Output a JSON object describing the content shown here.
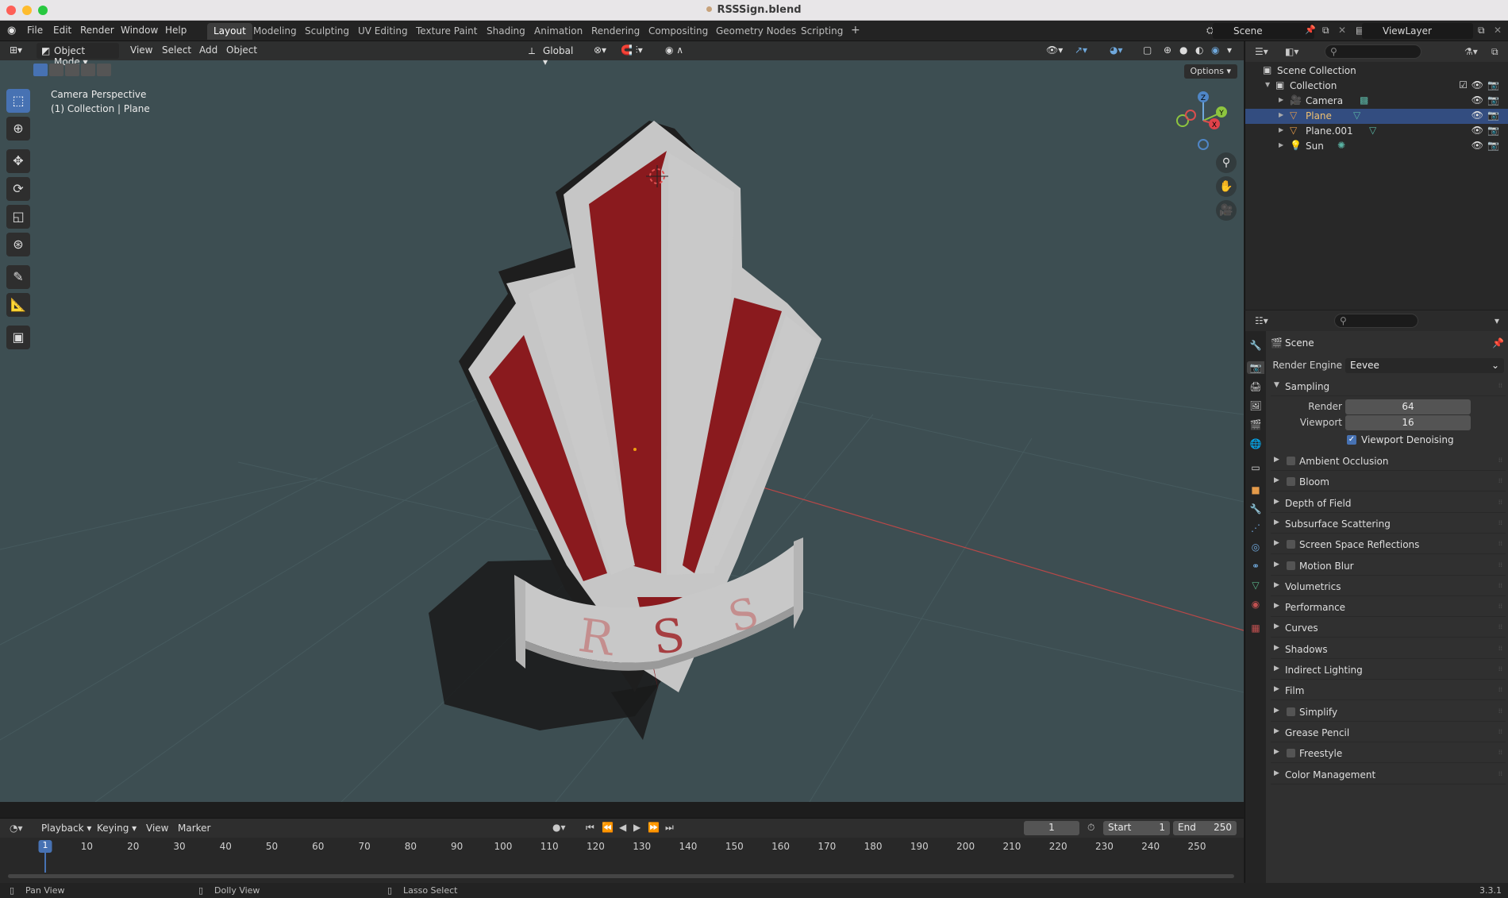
{
  "window": {
    "title": "RSSSign.blend"
  },
  "menu": {
    "items": [
      "File",
      "Edit",
      "Render",
      "Window",
      "Help"
    ]
  },
  "workspaces": {
    "tabs": [
      "Layout",
      "Modeling",
      "Sculpting",
      "UV Editing",
      "Texture Paint",
      "Shading",
      "Animation",
      "Rendering",
      "Compositing",
      "Geometry Nodes",
      "Scripting"
    ],
    "add": "+",
    "active": "Layout"
  },
  "scene_selector": {
    "value": "Scene"
  },
  "viewlayer_selector": {
    "value": "ViewLayer"
  },
  "viewport": {
    "mode": "Object Mode",
    "menus": [
      "View",
      "Select",
      "Add",
      "Object"
    ],
    "transform_orientation": "Global",
    "options_label": "Options",
    "overlay_line1": "Camera Perspective",
    "overlay_line2": "(1) Collection | Plane",
    "gizmo": {
      "z": "Z",
      "y": "Y",
      "x": "X"
    },
    "banner_text": [
      "R",
      "S",
      "S"
    ],
    "colors": {
      "background": "#3d4e52",
      "sign_red": "#8a1a1e",
      "sign_white": "#c9c9c9"
    }
  },
  "outliner": {
    "rows": [
      {
        "label": "Scene Collection",
        "icon": "scene-collection-icon"
      },
      {
        "label": "Collection",
        "icon": "collection-icon"
      },
      {
        "label": "Camera",
        "icon": "camera-icon"
      },
      {
        "label": "Plane",
        "icon": "mesh-icon"
      },
      {
        "label": "Plane.001",
        "icon": "mesh-icon"
      },
      {
        "label": "Sun",
        "icon": "light-icon"
      }
    ]
  },
  "properties": {
    "context_title": "Scene",
    "render_engine_label": "Render Engine",
    "render_engine_value": "Eevee",
    "sampling": {
      "title": "Sampling",
      "render_label": "Render",
      "render_value": "64",
      "viewport_label": "Viewport",
      "viewport_value": "16",
      "denoise_label": "Viewport Denoising"
    },
    "panels": [
      {
        "label": "Ambient Occlusion",
        "checkbox": true
      },
      {
        "label": "Bloom",
        "checkbox": true
      },
      {
        "label": "Depth of Field",
        "checkbox": false
      },
      {
        "label": "Subsurface Scattering",
        "checkbox": false
      },
      {
        "label": "Screen Space Reflections",
        "checkbox": true
      },
      {
        "label": "Motion Blur",
        "checkbox": true
      },
      {
        "label": "Volumetrics",
        "checkbox": false
      },
      {
        "label": "Performance",
        "checkbox": false
      },
      {
        "label": "Curves",
        "checkbox": false
      },
      {
        "label": "Shadows",
        "checkbox": false
      },
      {
        "label": "Indirect Lighting",
        "checkbox": false
      },
      {
        "label": "Film",
        "checkbox": false
      },
      {
        "label": "Simplify",
        "checkbox": true
      },
      {
        "label": "Grease Pencil",
        "checkbox": false
      },
      {
        "label": "Freestyle",
        "checkbox": true
      },
      {
        "label": "Color Management",
        "checkbox": false
      }
    ]
  },
  "timeline": {
    "menus": [
      "Playback",
      "Keying",
      "View",
      "Marker"
    ],
    "current_frame": "1",
    "start_label": "Start",
    "start_value": "1",
    "end_label": "End",
    "end_value": "250",
    "ticks": [
      "1",
      "10",
      "20",
      "30",
      "40",
      "50",
      "60",
      "70",
      "80",
      "90",
      "100",
      "110",
      "120",
      "130",
      "140",
      "150",
      "160",
      "170",
      "180",
      "190",
      "200",
      "210",
      "220",
      "230",
      "240",
      "250"
    ]
  },
  "statusbar": {
    "items": [
      "Pan View",
      "Dolly View",
      "Lasso Select"
    ],
    "version": "3.3.1"
  }
}
